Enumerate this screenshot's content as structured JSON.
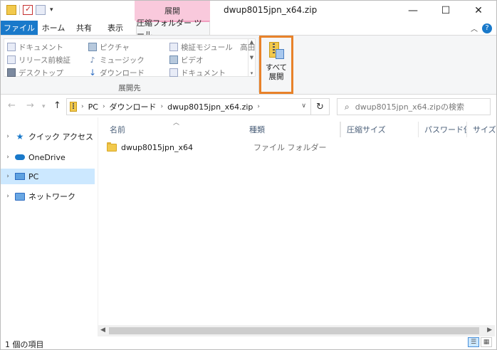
{
  "title_bar": {
    "context_tab_label": "展開",
    "window_title": "dwup8015jpn_x64.zip",
    "minimize": "—",
    "maximize": "☐",
    "close": "✕"
  },
  "ribbon_tabs": {
    "file": "ファイル",
    "home": "ホーム",
    "share": "共有",
    "view": "表示",
    "compressed_folder_tools": "圧縮フォルダー ツール"
  },
  "ribbon": {
    "destinations": {
      "col1": [
        "ドキュメント",
        "リリース前検証",
        "デスクトップ"
      ],
      "col2": [
        "ピクチャ",
        "ミュージック",
        "ダウンロード"
      ],
      "col3": [
        "検証モジュール　高田",
        "ビデオ",
        "ドキュメント"
      ]
    },
    "group_label": "展開先",
    "extract_all_line1": "すべて",
    "extract_all_line2": "展開"
  },
  "address_bar": {
    "crumbs": [
      "PC",
      "ダウンロード",
      "dwup8015jpn_x64.zip"
    ],
    "search_placeholder": "dwup8015jpn_x64.zipの検索"
  },
  "nav_pane": {
    "items": [
      "クイック アクセス",
      "OneDrive",
      "PC",
      "ネットワーク"
    ]
  },
  "columns": {
    "name": "名前",
    "type": "種類",
    "compressed_size": "圧縮サイズ",
    "password_protected": "パスワード保...",
    "size": "サイズ"
  },
  "files": [
    {
      "name": "dwup8015jpn_x64",
      "type": "ファイル フォルダー"
    }
  ],
  "status_bar": {
    "item_count": "1 個の項目"
  }
}
